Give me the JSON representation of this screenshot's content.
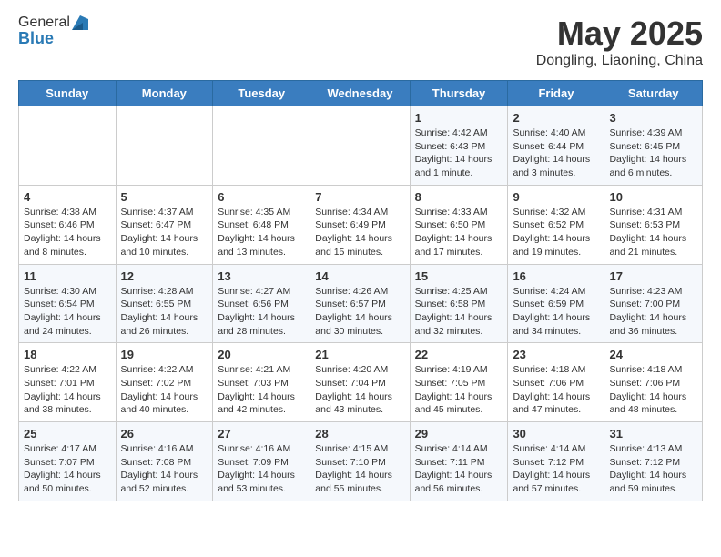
{
  "header": {
    "logo_general": "General",
    "logo_blue": "Blue",
    "main_title": "May 2025",
    "subtitle": "Dongling, Liaoning, China"
  },
  "days_of_week": [
    "Sunday",
    "Monday",
    "Tuesday",
    "Wednesday",
    "Thursday",
    "Friday",
    "Saturday"
  ],
  "weeks": [
    [
      {
        "day": "",
        "info": ""
      },
      {
        "day": "",
        "info": ""
      },
      {
        "day": "",
        "info": ""
      },
      {
        "day": "",
        "info": ""
      },
      {
        "day": "1",
        "info": "Sunrise: 4:42 AM\nSunset: 6:43 PM\nDaylight: 14 hours and 1 minute."
      },
      {
        "day": "2",
        "info": "Sunrise: 4:40 AM\nSunset: 6:44 PM\nDaylight: 14 hours and 3 minutes."
      },
      {
        "day": "3",
        "info": "Sunrise: 4:39 AM\nSunset: 6:45 PM\nDaylight: 14 hours and 6 minutes."
      }
    ],
    [
      {
        "day": "4",
        "info": "Sunrise: 4:38 AM\nSunset: 6:46 PM\nDaylight: 14 hours and 8 minutes."
      },
      {
        "day": "5",
        "info": "Sunrise: 4:37 AM\nSunset: 6:47 PM\nDaylight: 14 hours and 10 minutes."
      },
      {
        "day": "6",
        "info": "Sunrise: 4:35 AM\nSunset: 6:48 PM\nDaylight: 14 hours and 13 minutes."
      },
      {
        "day": "7",
        "info": "Sunrise: 4:34 AM\nSunset: 6:49 PM\nDaylight: 14 hours and 15 minutes."
      },
      {
        "day": "8",
        "info": "Sunrise: 4:33 AM\nSunset: 6:50 PM\nDaylight: 14 hours and 17 minutes."
      },
      {
        "day": "9",
        "info": "Sunrise: 4:32 AM\nSunset: 6:52 PM\nDaylight: 14 hours and 19 minutes."
      },
      {
        "day": "10",
        "info": "Sunrise: 4:31 AM\nSunset: 6:53 PM\nDaylight: 14 hours and 21 minutes."
      }
    ],
    [
      {
        "day": "11",
        "info": "Sunrise: 4:30 AM\nSunset: 6:54 PM\nDaylight: 14 hours and 24 minutes."
      },
      {
        "day": "12",
        "info": "Sunrise: 4:28 AM\nSunset: 6:55 PM\nDaylight: 14 hours and 26 minutes."
      },
      {
        "day": "13",
        "info": "Sunrise: 4:27 AM\nSunset: 6:56 PM\nDaylight: 14 hours and 28 minutes."
      },
      {
        "day": "14",
        "info": "Sunrise: 4:26 AM\nSunset: 6:57 PM\nDaylight: 14 hours and 30 minutes."
      },
      {
        "day": "15",
        "info": "Sunrise: 4:25 AM\nSunset: 6:58 PM\nDaylight: 14 hours and 32 minutes."
      },
      {
        "day": "16",
        "info": "Sunrise: 4:24 AM\nSunset: 6:59 PM\nDaylight: 14 hours and 34 minutes."
      },
      {
        "day": "17",
        "info": "Sunrise: 4:23 AM\nSunset: 7:00 PM\nDaylight: 14 hours and 36 minutes."
      }
    ],
    [
      {
        "day": "18",
        "info": "Sunrise: 4:22 AM\nSunset: 7:01 PM\nDaylight: 14 hours and 38 minutes."
      },
      {
        "day": "19",
        "info": "Sunrise: 4:22 AM\nSunset: 7:02 PM\nDaylight: 14 hours and 40 minutes."
      },
      {
        "day": "20",
        "info": "Sunrise: 4:21 AM\nSunset: 7:03 PM\nDaylight: 14 hours and 42 minutes."
      },
      {
        "day": "21",
        "info": "Sunrise: 4:20 AM\nSunset: 7:04 PM\nDaylight: 14 hours and 43 minutes."
      },
      {
        "day": "22",
        "info": "Sunrise: 4:19 AM\nSunset: 7:05 PM\nDaylight: 14 hours and 45 minutes."
      },
      {
        "day": "23",
        "info": "Sunrise: 4:18 AM\nSunset: 7:06 PM\nDaylight: 14 hours and 47 minutes."
      },
      {
        "day": "24",
        "info": "Sunrise: 4:18 AM\nSunset: 7:06 PM\nDaylight: 14 hours and 48 minutes."
      }
    ],
    [
      {
        "day": "25",
        "info": "Sunrise: 4:17 AM\nSunset: 7:07 PM\nDaylight: 14 hours and 50 minutes."
      },
      {
        "day": "26",
        "info": "Sunrise: 4:16 AM\nSunset: 7:08 PM\nDaylight: 14 hours and 52 minutes."
      },
      {
        "day": "27",
        "info": "Sunrise: 4:16 AM\nSunset: 7:09 PM\nDaylight: 14 hours and 53 minutes."
      },
      {
        "day": "28",
        "info": "Sunrise: 4:15 AM\nSunset: 7:10 PM\nDaylight: 14 hours and 55 minutes."
      },
      {
        "day": "29",
        "info": "Sunrise: 4:14 AM\nSunset: 7:11 PM\nDaylight: 14 hours and 56 minutes."
      },
      {
        "day": "30",
        "info": "Sunrise: 4:14 AM\nSunset: 7:12 PM\nDaylight: 14 hours and 57 minutes."
      },
      {
        "day": "31",
        "info": "Sunrise: 4:13 AM\nSunset: 7:12 PM\nDaylight: 14 hours and 59 minutes."
      }
    ]
  ]
}
